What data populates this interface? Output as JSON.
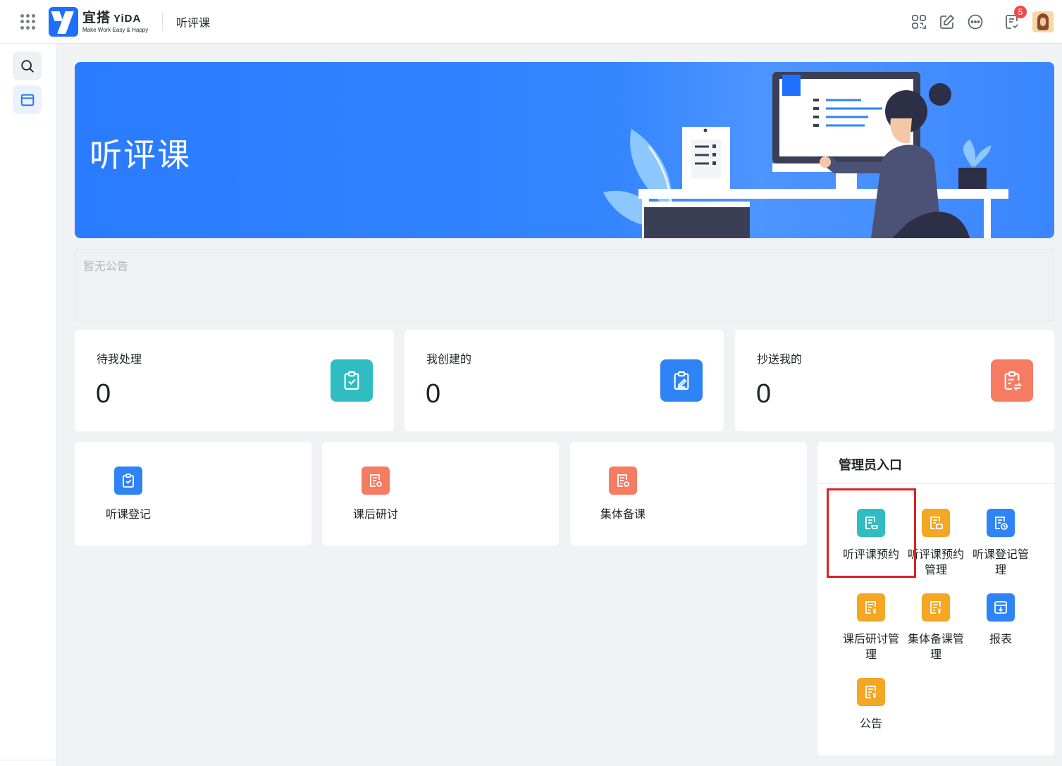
{
  "topbar": {
    "logo_main": "宜搭",
    "logo_brand": "YiDA",
    "logo_sub": "Make Work Easy & Happy",
    "app_title": "听评课",
    "notification_count": "5"
  },
  "banner": {
    "title": "听评课"
  },
  "notice": {
    "text": "暂无公告"
  },
  "stats": [
    {
      "label": "待我处理",
      "value": "0",
      "color": "#2fbdc1"
    },
    {
      "label": "我创建的",
      "value": "0",
      "color": "#2e83f6"
    },
    {
      "label": "抄送我的",
      "value": "0",
      "color": "#f57c62"
    }
  ],
  "entries": [
    {
      "label": "听课登记",
      "color": "#2e83f6"
    },
    {
      "label": "课后研讨",
      "color": "#f57c62"
    },
    {
      "label": "集体备课",
      "color": "#f57c62"
    }
  ],
  "admin": {
    "title": "管理员入口",
    "items": [
      {
        "label": "听评课预约",
        "color": "#2fbdc1"
      },
      {
        "label": "听评课预约管理",
        "color": "#f5a623"
      },
      {
        "label": "听课登记管理",
        "color": "#2e83f6"
      },
      {
        "label": "课后研讨管理",
        "color": "#f5a623"
      },
      {
        "label": "集体备课管理",
        "color": "#f5a623"
      },
      {
        "label": "报表",
        "color": "#2e83f6"
      },
      {
        "label": "公告",
        "color": "#f5a623"
      }
    ]
  }
}
